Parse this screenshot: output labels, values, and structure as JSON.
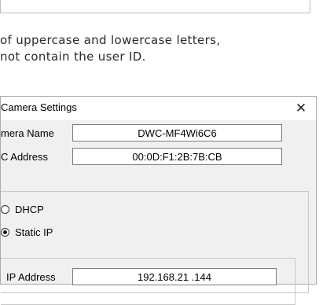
{
  "document": {
    "lines": [
      "of uppercase and lowercase letters,",
      "not contain the user ID."
    ]
  },
  "dialog": {
    "title": "Camera Settings",
    "close_glyph": "✕",
    "fields": {
      "camera_name": {
        "label": "mera Name",
        "value": "DWC-MF4Wi6C6"
      },
      "mac_address": {
        "label": "C Address",
        "value": "00:0D:F1:2B:7B:CB"
      },
      "ip_address": {
        "label": "IP Address",
        "value": "192.168.21 .144"
      }
    },
    "ip_mode": {
      "options": [
        {
          "label": "DHCP",
          "selected": false
        },
        {
          "label": "Static IP",
          "selected": true
        }
      ]
    }
  },
  "icons": {
    "close": "close-icon",
    "radio_dhcp": "radio-unchecked-icon",
    "radio_static": "radio-checked-icon"
  }
}
